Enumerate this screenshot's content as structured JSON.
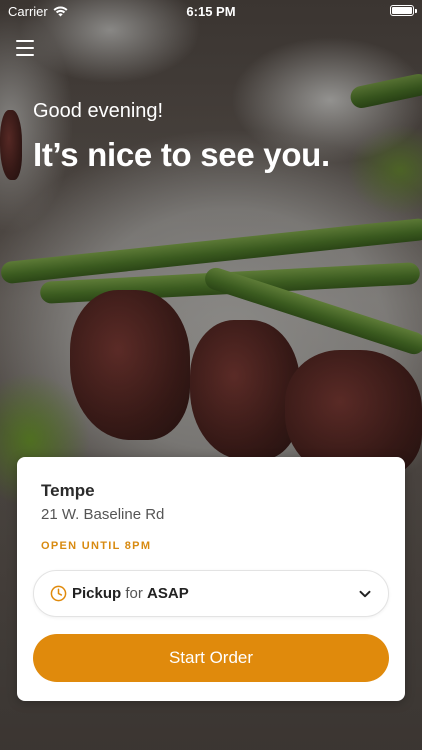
{
  "status_bar": {
    "carrier": "Carrier",
    "time": "6:15 PM"
  },
  "header": {
    "menu_icon": "hamburger-menu-icon"
  },
  "hero": {
    "greeting": "Good evening!",
    "headline": "It’s nice to see you."
  },
  "location_card": {
    "store_name": "Tempe",
    "address": "21 W. Baseline Rd",
    "hours": "OPEN UNTIL 8PM",
    "pickup": {
      "mode": "Pickup",
      "connector": "for",
      "time": "ASAP",
      "icon": "clock-icon",
      "dropdown_icon": "chevron-down-icon"
    },
    "start_button_label": "Start Order"
  },
  "colors": {
    "accent": "#e08a0c",
    "hours_text": "#d88a10"
  }
}
